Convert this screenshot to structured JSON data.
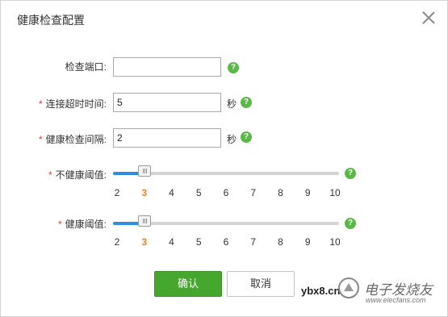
{
  "dialog": {
    "title": "健康检查配置",
    "close_icon": "close-icon"
  },
  "form": {
    "port": {
      "label": "检查端口:",
      "required": false,
      "value": "",
      "help": "?"
    },
    "timeout": {
      "label": "连接超时时间:",
      "required": true,
      "required_mark": "*",
      "value": "5",
      "unit": "秒",
      "help": "?"
    },
    "interval": {
      "label": "健康检查间隔:",
      "required": true,
      "required_mark": "*",
      "value": "2",
      "unit": "秒",
      "help": "?"
    },
    "unhealthy_threshold": {
      "label": "不健康阈值:",
      "required": true,
      "required_mark": "*",
      "ticks": [
        "2",
        "3",
        "4",
        "5",
        "6",
        "7",
        "8",
        "9",
        "10"
      ],
      "selected": "3",
      "help": "?"
    },
    "healthy_threshold": {
      "label": "健康阈值:",
      "required": true,
      "required_mark": "*",
      "ticks": [
        "2",
        "3",
        "4",
        "5",
        "6",
        "7",
        "8",
        "9",
        "10"
      ],
      "selected": "3",
      "help": "?"
    }
  },
  "buttons": {
    "confirm": "确认",
    "cancel": "取消"
  },
  "watermark": {
    "site": "ybx8.cn",
    "brand": "电子发烧友",
    "url": "www.elecfans.com"
  },
  "colors": {
    "accent_green": "#46a72e",
    "help_green": "#5ab946",
    "slider_blue": "#2f8ee0",
    "required_red": "#e03c3c",
    "selected_orange": "#e8842c"
  }
}
